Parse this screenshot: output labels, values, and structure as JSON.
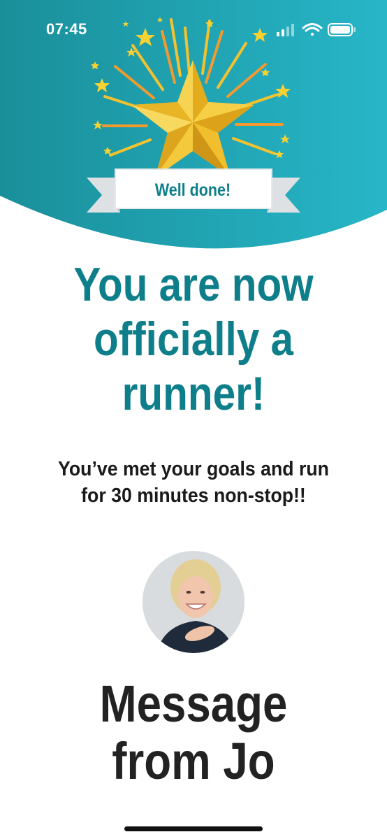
{
  "status_bar": {
    "time": "07:45",
    "icons": [
      "signal-icon",
      "wifi-icon",
      "battery-icon"
    ]
  },
  "hero": {
    "badge_text": "Well done!",
    "icons": [
      "star-icon",
      "ribbon-banner"
    ]
  },
  "main": {
    "headline": "You are now\nofficially a\nrunner!",
    "subtext": "You’ve met your goals and run\nfor 30 minutes non-stop!!",
    "avatar_icon": "jo-avatar",
    "message_title": "Message\nfrom Jo"
  },
  "colors": {
    "teal_start": "#1a8f9a",
    "teal_end": "#27b6c8",
    "headline": "#0e7f8a",
    "star_gold": "#f3c233",
    "ribbon_grey": "#e3e6e8"
  }
}
